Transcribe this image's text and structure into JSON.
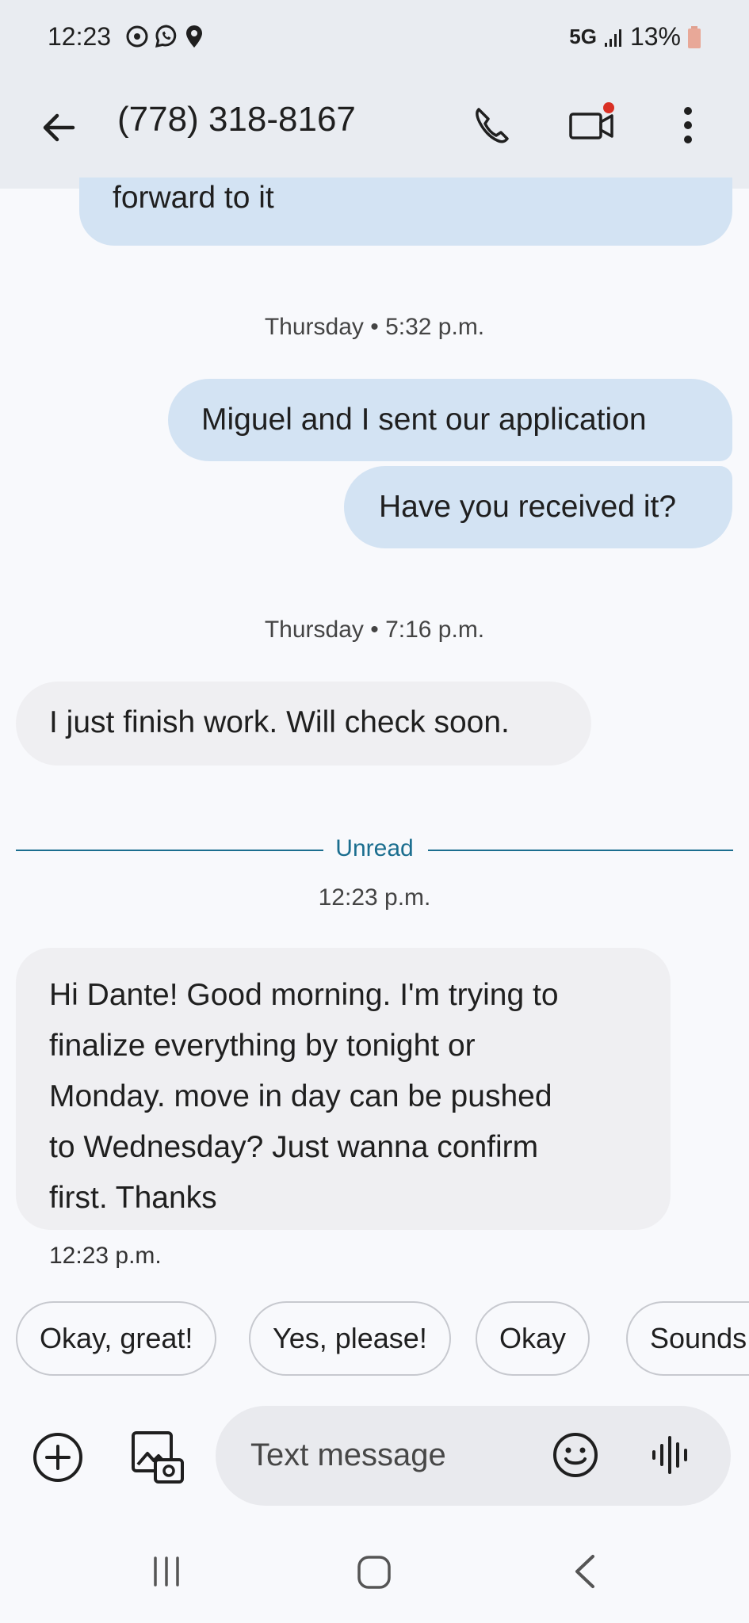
{
  "status_bar": {
    "time": "12:23",
    "network": "5G",
    "battery": "13%",
    "icons": [
      "sync-icon",
      "whatsapp-icon",
      "location-icon"
    ]
  },
  "header": {
    "title": "(778) 318-8167",
    "actions": [
      "back-arrow-icon",
      "phone-icon",
      "video-call-icon",
      "more-vert-icon"
    ]
  },
  "messages": {
    "m0": {
      "direction": "outgoing",
      "text": "forward to it"
    },
    "ts1": "Thursday • 5:32 p.m.",
    "m1": {
      "direction": "outgoing",
      "text": "Miguel and I sent our application"
    },
    "m2": {
      "direction": "outgoing",
      "text": "Have you received it?"
    },
    "ts2": "Thursday • 7:16 p.m.",
    "m3": {
      "direction": "incoming",
      "text": "I just finish work. Will check soon."
    },
    "unread_label": "Unread",
    "ts3": "12:23 p.m.",
    "m4": {
      "direction": "incoming",
      "lines": [
        "Hi Dante! Good morning. I'm trying to",
        "finalize everything by tonight or",
        "Monday. move in day can be pushed",
        "to Wednesday? Just wanna confirm",
        "first. Thanks"
      ]
    },
    "m4_time": "12:23 p.m."
  },
  "smart_replies": [
    "Okay, great!",
    "Yes, please!",
    "Okay",
    "Sounds"
  ],
  "composer": {
    "placeholder": "Text message"
  },
  "colors": {
    "outgoing_bubble": "#d3e3f3",
    "incoming_bubble": "#efeff2",
    "unread_accent": "#1b6e8f",
    "video_badge": "#d93025"
  }
}
